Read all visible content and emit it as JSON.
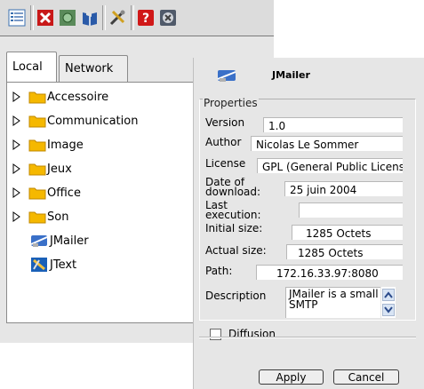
{
  "toolbar": {
    "icons": [
      "list-view-icon",
      "delete-icon",
      "green-round-icon",
      "book-icon",
      "tools-icon",
      "help-icon",
      "close-icon"
    ]
  },
  "tabs": {
    "local": "Local",
    "network": "Network"
  },
  "tree": {
    "folders": [
      "Accessoire",
      "Communication",
      "Image",
      "Jeux",
      "Office",
      "Son"
    ],
    "apps": [
      "JMailer",
      "JText"
    ]
  },
  "dialog": {
    "title": "JMailer",
    "section": "Properties",
    "fields": {
      "version": {
        "label": "Version",
        "value": "1.0"
      },
      "author": {
        "label": "Author",
        "value": "Nicolas Le Sommer"
      },
      "license": {
        "label": "License",
        "value": "GPL (General Public License)"
      },
      "date_of_download": {
        "label": "Date of download:",
        "value": "25 juin 2004"
      },
      "last_execution": {
        "label": "Last execution:",
        "value": ""
      },
      "initial_size": {
        "label": "Initial size:",
        "value": "1285 Octets"
      },
      "actual_size": {
        "label": "Actual size:",
        "value": "1285 Octets"
      },
      "path": {
        "label": "Path:",
        "value": "172.16.33.97:8080"
      },
      "description": {
        "label": "Description",
        "value": "JMailer is a small SMTP"
      }
    },
    "diffusion": {
      "label": "Diffusion",
      "checked": false
    },
    "buttons": {
      "apply": "Apply",
      "cancel": "Cancel"
    }
  },
  "colors": {
    "folder": "#f5b800",
    "window_bg": "#e6e6e6",
    "scroll_button": "#d8e4f4"
  }
}
